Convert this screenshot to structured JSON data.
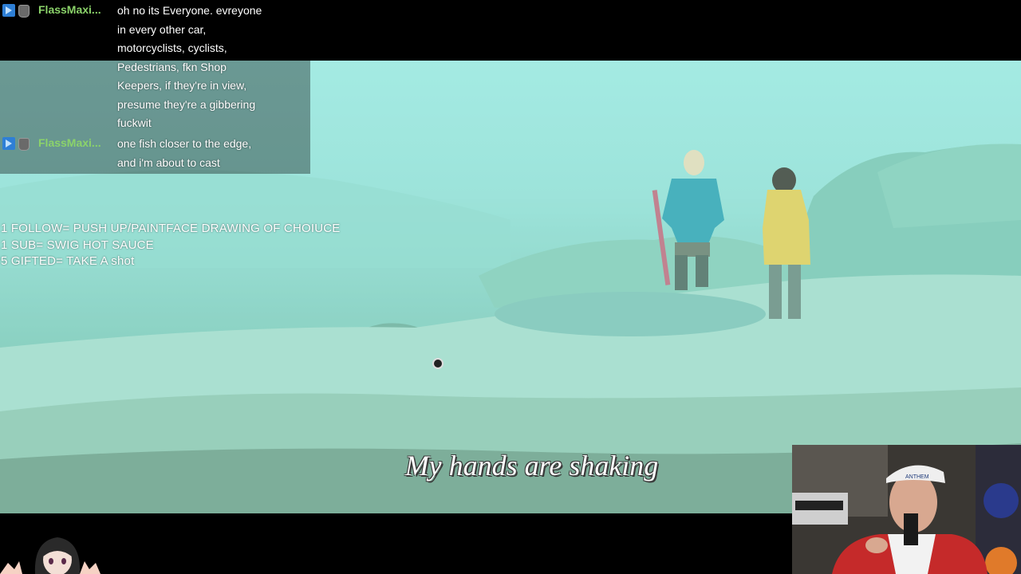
{
  "chat": {
    "messages": [
      {
        "user": "FlassMaxi...",
        "badges": [
          "prime-icon",
          "subscriber-icon"
        ],
        "lines": [
          "oh no its Everyone. evreyone",
          "in every other car,",
          "motorcyclists, cyclists,",
          "Pedestrians, fkn Shop",
          "Keepers, if they're in view,",
          "presume they're a gibbering",
          "fuckwit"
        ]
      },
      {
        "user": "FlassMaxi...",
        "badges": [
          "prime-icon",
          "subscriber-icon"
        ],
        "lines": [
          "one fish closer to the edge,",
          "and i'm about to cast"
        ]
      }
    ],
    "username_color": "#8bd36a"
  },
  "goals": {
    "line1": "1 FOLLOW= PUSH UP/PAINTFACE DRAWING OF CHOIUCE",
    "line2": "1 SUB= SWIG HOT SAUCE",
    "line3": "5 GIFTED= TAKE A shot"
  },
  "game": {
    "subtitle": "My hands are shaking",
    "fog_color": "#9fe9e1"
  },
  "webcam": {
    "cap_text": "ANTHEM"
  }
}
